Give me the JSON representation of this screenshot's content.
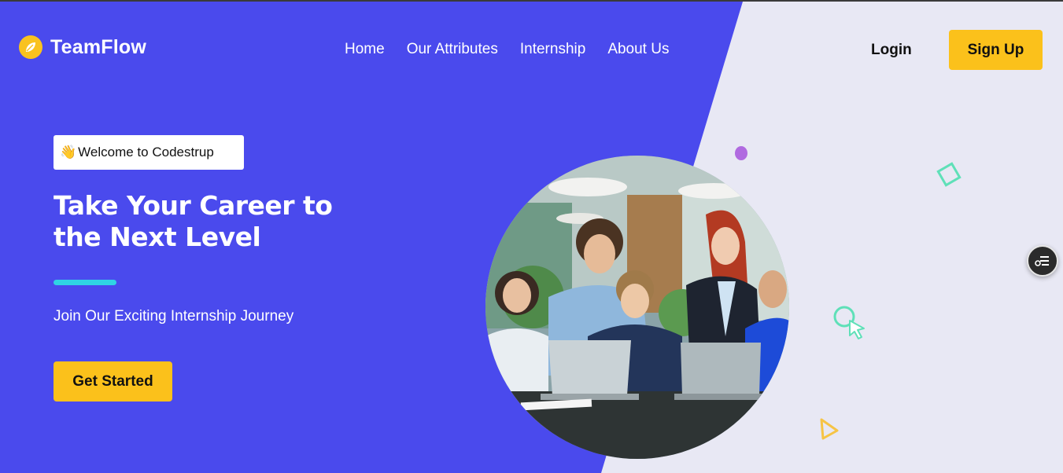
{
  "brand": {
    "name": "TeamFlow",
    "logo_icon": "leaf-icon",
    "logo_color": "#f9c21f"
  },
  "nav": {
    "items": [
      {
        "label": "Home"
      },
      {
        "label": "Our Attributes"
      },
      {
        "label": "Internship"
      },
      {
        "label": "About Us"
      }
    ]
  },
  "auth": {
    "login_label": "Login",
    "signup_label": "Sign Up"
  },
  "hero": {
    "welcome_emoji": "👋",
    "welcome_text": "Welcome to Codestrup",
    "title_line1": "Take Your Career to",
    "title_line2": "the Next Level",
    "subtitle": "Join Our Exciting Internship Journey",
    "cta_label": "Get Started",
    "image_subject": "team-working-at-laptops-photo"
  },
  "colors": {
    "primary": "#4a4aed",
    "accent_yellow": "#fbc11b",
    "accent_cyan": "#2fd4e4",
    "background_light": "#e8e8f4",
    "deco_purple": "#b06ae0",
    "deco_teal": "#5fe0b8"
  },
  "icons": {
    "side_widget": "menu-settings-icon",
    "deco": [
      "purple-dot",
      "teal-diamond",
      "cursor-click-icon",
      "yellow-triangle"
    ]
  }
}
